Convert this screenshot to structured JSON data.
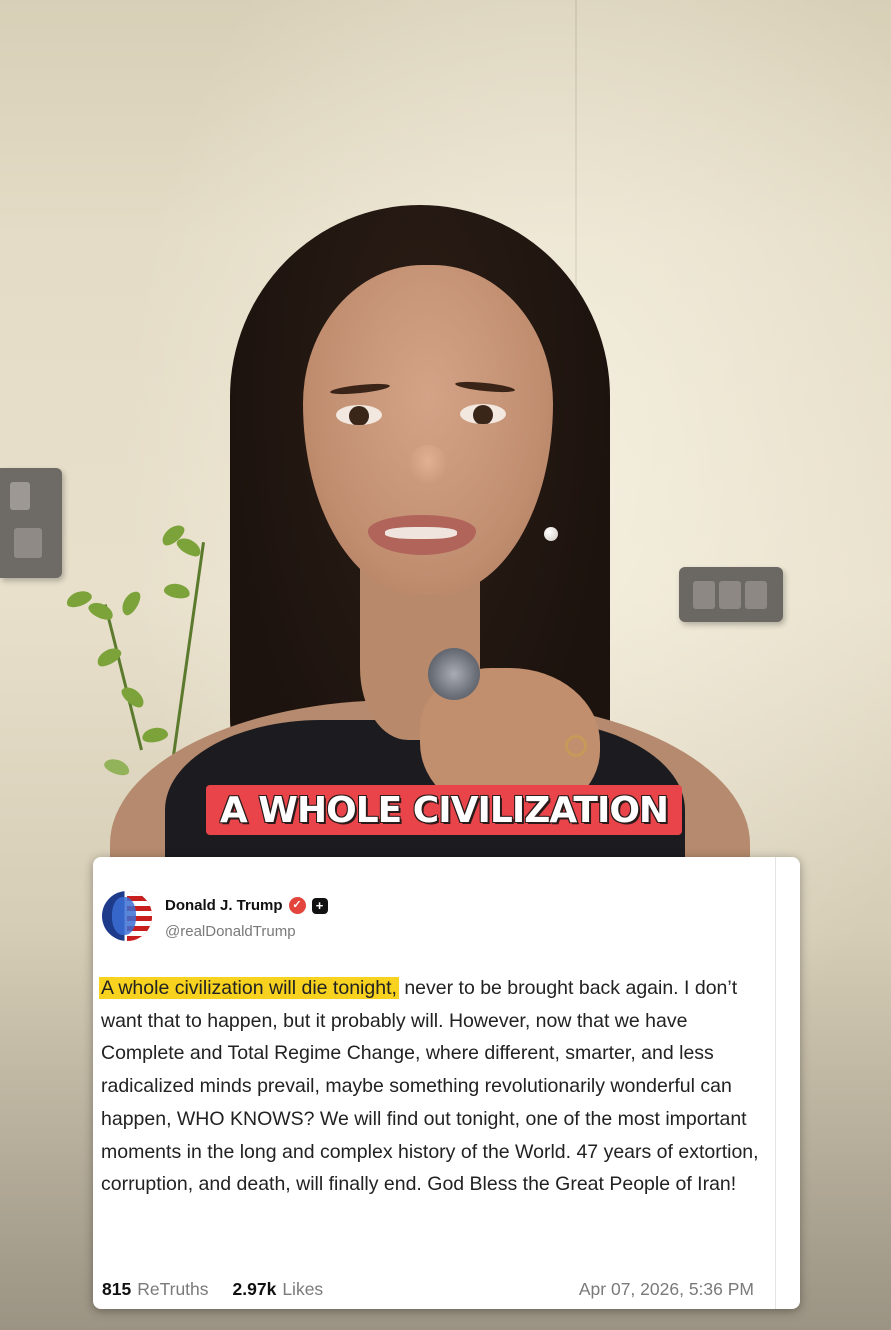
{
  "video": {
    "caption": "A WHOLE CIVILIZATION"
  },
  "post": {
    "author_name": "Donald J. Trump",
    "author_handle": "@realDonaldTrump",
    "verified_icon": "verified-check-icon",
    "plus_icon": "plus-badge-icon",
    "text_highlight": "A whole civilization will die tonight,",
    "text_body": " never to be brought back again. I don’t want that to happen, but it probably will. However, now that we have Complete and Total Regime Change, where different, smarter, and less radicalized minds prevail, maybe something revolutionarily wonderful can happen, WHO KNOWS? We will find out tonight, one of the most important moments in the long and complex history of the World. 47 years of extortion, corruption, and death, will finally end. God Bless the Great People of Iran!",
    "retruths_count": "815",
    "retruths_label": "ReTruths",
    "likes_count": "2.97k",
    "likes_label": "Likes",
    "timestamp": "Apr 07, 2026, 5:36 PM"
  },
  "colors": {
    "caption_bg": "#e8444a",
    "highlight": "#f7d21e",
    "verified": "#e3443b"
  }
}
